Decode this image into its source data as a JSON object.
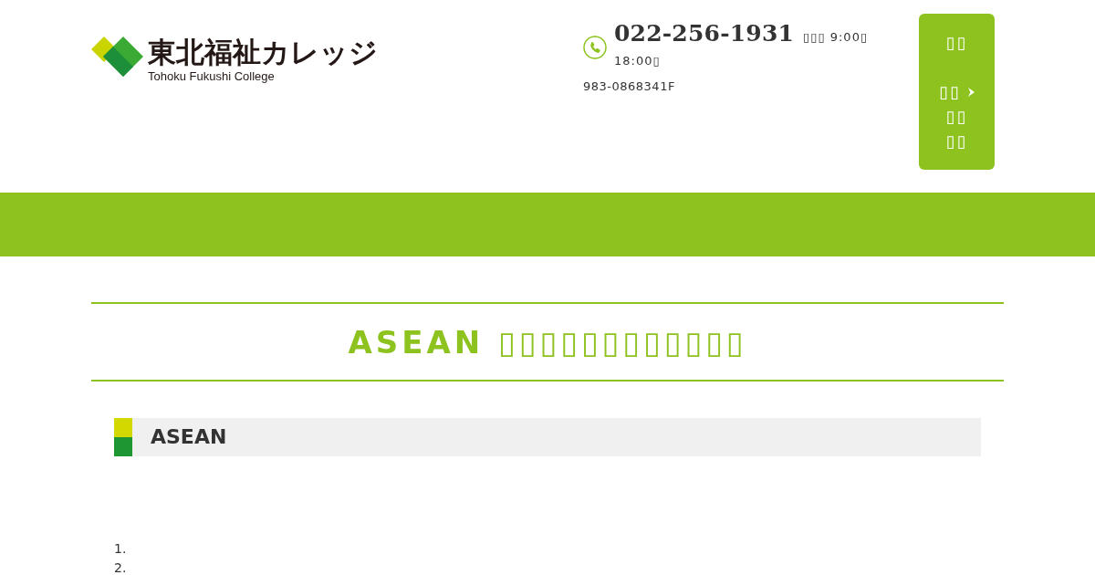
{
  "header": {
    "logo": {
      "name": "東北福祉カレッジ",
      "tagline": "Tohoku Fukushi College"
    },
    "contact": {
      "phone": "022-256-1931",
      "hours_open": "▯▯▯ 9:00▯",
      "hours_close": "18:00▯",
      "address": "983-0868341F"
    },
    "menu_panel": {
      "items": [
        {
          "kind": "label",
          "lines": [
            "▯▯"
          ]
        },
        {
          "kind": "link",
          "lines": [
            "▯▯",
            "▯▯",
            "▯▯"
          ]
        }
      ]
    }
  },
  "page_title": "ASEAN ▯▯▯▯▯▯▯▯▯▯▯▯",
  "section": {
    "heading": "ASEAN"
  },
  "list": {
    "items": [
      {
        "number": "1."
      },
      {
        "number": "2."
      }
    ]
  }
}
